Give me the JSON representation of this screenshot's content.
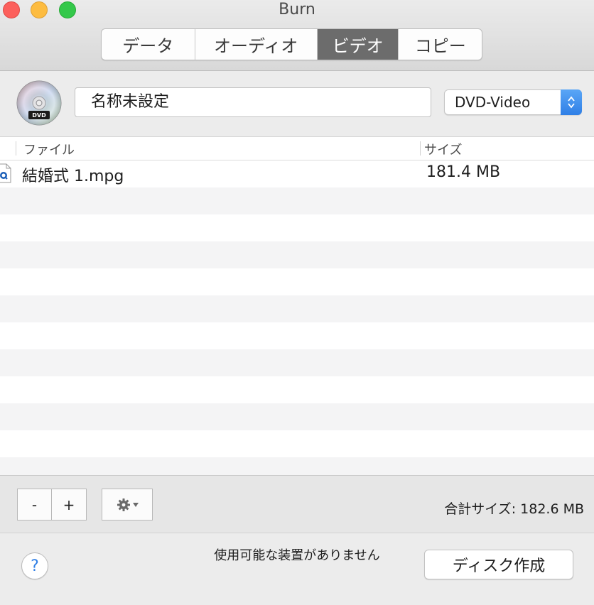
{
  "window": {
    "title": "Burn"
  },
  "tabs": [
    {
      "label": "データ",
      "active": false
    },
    {
      "label": "オーディオ",
      "active": false
    },
    {
      "label": "ビデオ",
      "active": true
    },
    {
      "label": "コピー",
      "active": false
    }
  ],
  "disc": {
    "icon": "dvd-disc-icon",
    "name_value": "名称未設定",
    "type_selected": "DVD-Video"
  },
  "table": {
    "columns": {
      "file": "ファイル",
      "size": "サイズ"
    },
    "rows": [
      {
        "name": "結婚式 1.mpg",
        "size": "181.4 MB",
        "icon": "quicktime-file-icon"
      }
    ]
  },
  "controls": {
    "remove_label": "-",
    "add_label": "+",
    "action_icon": "gear-icon",
    "total_label": "合計サイズ: 182.6 MB"
  },
  "footer": {
    "help_label": "?",
    "status_text": "使用可能な装置がありません",
    "burn_label": "ディスク作成"
  },
  "colors": {
    "accent": "#2f7fe6",
    "active_tab": "#6c6c6c"
  }
}
